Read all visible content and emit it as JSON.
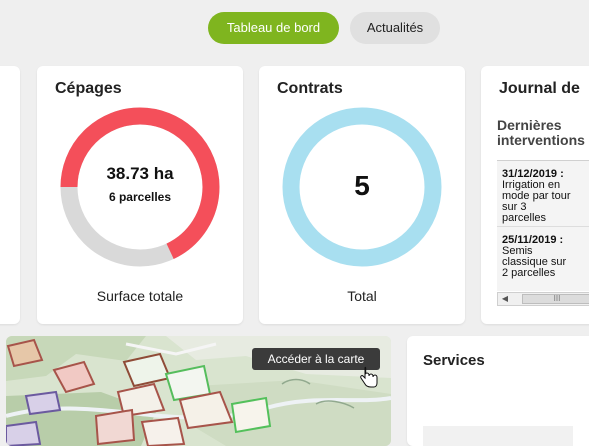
{
  "tabs": {
    "active": "Tableau de bord",
    "inactive": "Actualités"
  },
  "cepages": {
    "title": "Cépages",
    "value": "38.73 ha",
    "subvalue": "6 parcelles",
    "caption": "Surface totale",
    "ring_fraction": 0.68,
    "ring_color": "#f44f5a",
    "track_color": "#d9d9d9"
  },
  "contrats": {
    "title": "Contrats",
    "value": "5",
    "caption": "Total",
    "ring_fraction": 1,
    "ring_color": "#a8dff0"
  },
  "journal": {
    "title": "Journal de",
    "subtitle_line1": "Dernières",
    "subtitle_line2": "interventions",
    "entries": [
      {
        "date": "31/12/2019 :",
        "lines": [
          "Irrigation en",
          "mode par tour",
          "sur 3",
          "parcelles"
        ]
      },
      {
        "date": "25/11/2019 :",
        "lines": [
          "Semis",
          "classique sur",
          "2 parcelles"
        ]
      }
    ],
    "scroll_left": "◀",
    "scroll_thumb": "III"
  },
  "map": {
    "button_label": "Accéder à la carte"
  },
  "services": {
    "title": "Services"
  },
  "colors": {
    "accent": "#7fb51f",
    "background": "#efefef"
  }
}
